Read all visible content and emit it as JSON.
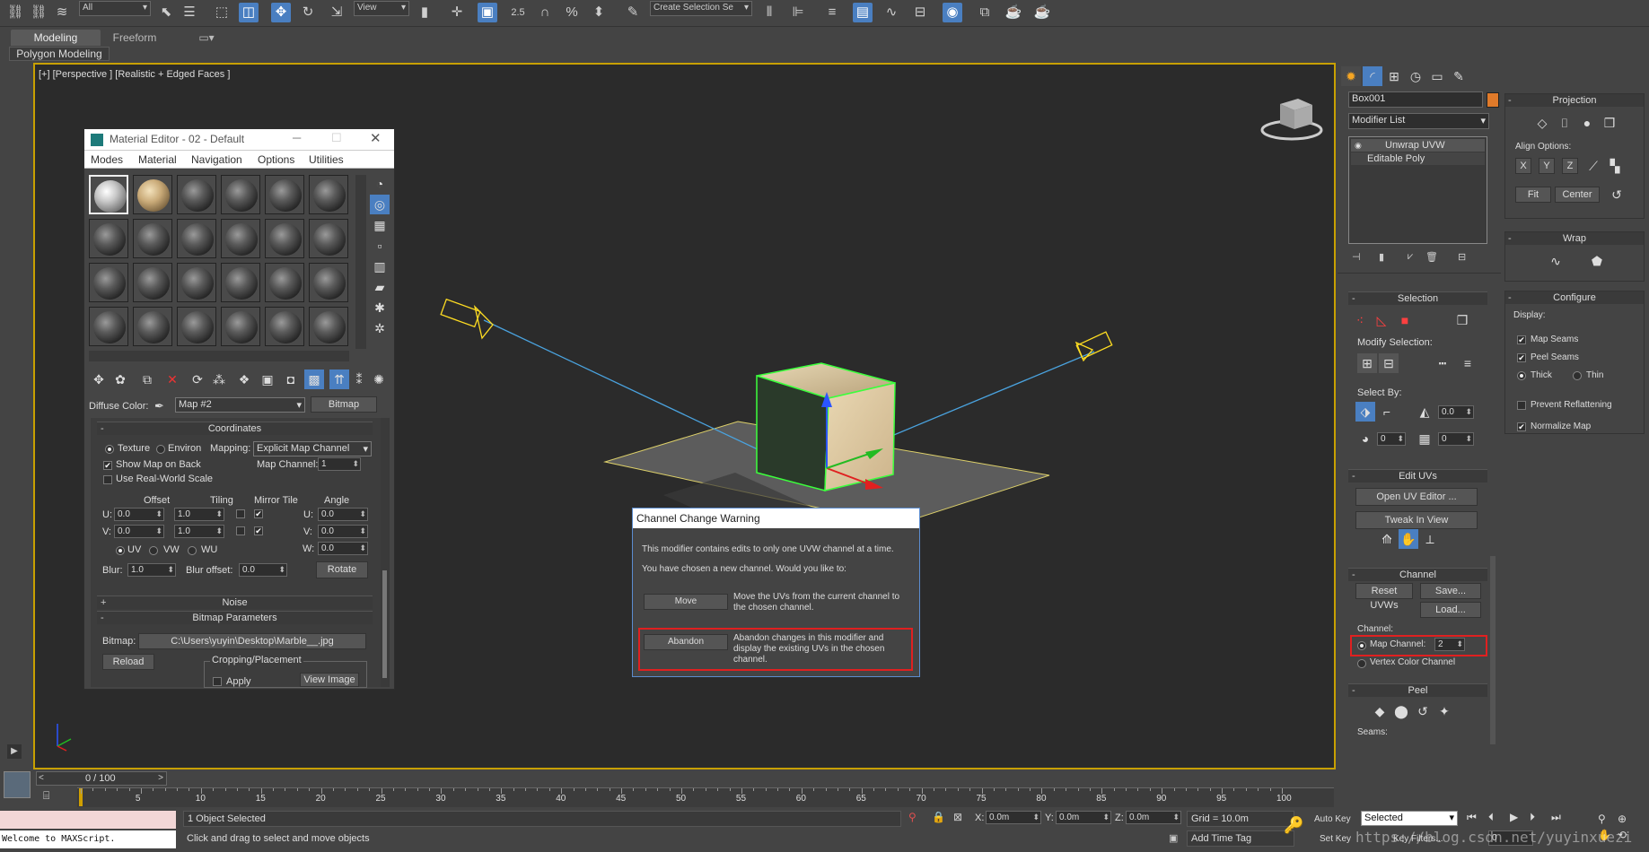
{
  "toolbar": {
    "filter_select": "All",
    "ref_coord_select": "View",
    "snap_label": "2.5",
    "named_selection_placeholder": "Create Selection Se"
  },
  "ribbon": {
    "tabs": [
      "Modeling",
      "Freeform"
    ],
    "subtab": "Polygon Modeling"
  },
  "viewport": {
    "label": "[+] [Perspective ] [Realistic + Edged Faces ]"
  },
  "material_editor": {
    "title": "Material Editor - 02 - Default",
    "menu": [
      "Modes",
      "Material",
      "Navigation",
      "Options",
      "Utilities"
    ],
    "diffuse_label": "Diffuse Color:",
    "map_name": "Map #2",
    "map_type": "Bitmap",
    "coordinates": {
      "title": "Coordinates",
      "texture": "Texture",
      "environ": "Environ",
      "mapping_label": "Mapping:",
      "mapping_value": "Explicit Map Channel",
      "show_map_on_back": "Show Map on Back",
      "map_channel_label": "Map Channel:",
      "map_channel_value": "1",
      "use_real_world": "Use Real-World Scale",
      "offset": "Offset",
      "tiling": "Tiling",
      "mirror_tile": "Mirror Tile",
      "angle": "Angle",
      "u": "U:",
      "v": "V:",
      "w": "W:",
      "u_offset": "0.0",
      "v_offset": "0.0",
      "u_tiling": "1.0",
      "v_tiling": "1.0",
      "u_angle": "0.0",
      "v_angle": "0.0",
      "w_angle": "0.0",
      "uv": "UV",
      "vw": "VW",
      "wu": "WU",
      "blur_label": "Blur:",
      "blur_value": "1.0",
      "blur_offset_label": "Blur offset:",
      "blur_offset_value": "0.0",
      "rotate": "Rotate"
    },
    "noise_title": "Noise",
    "bitmap_params_title": "Bitmap Parameters",
    "bitmap_label": "Bitmap:",
    "bitmap_path": "C:\\Users\\yuyin\\Desktop\\Marble__.jpg",
    "reload": "Reload",
    "cropping": "Cropping/Placement",
    "apply": "Apply",
    "view_image": "View Image"
  },
  "dialog": {
    "title": "Channel Change Warning",
    "line1": "This modifier contains edits to only one UVW channel at a time.",
    "line2": "You have chosen a new channel. Would you like to:",
    "move_label": "Move",
    "move_desc": "Move the UVs from the current channel to the chosen channel.",
    "abandon_label": "Abandon",
    "abandon_desc": "Abandon changes in this modifier and display the existing UVs in the chosen channel."
  },
  "command_panel": {
    "object_name": "Box001",
    "object_color": "#e07a2a",
    "modifier_list": "Modifier List",
    "stack": [
      "Unwrap UVW",
      "Editable Poly"
    ],
    "selection_title": "Selection",
    "modify_selection": "Modify Selection:",
    "select_by": "Select By:",
    "select_by_angle": "0.0",
    "select_by_v1": "0",
    "select_by_v2": "0",
    "edit_uvs_title": "Edit UVs",
    "open_uv_editor": "Open UV Editor ...",
    "tweak_in_view": "Tweak In View",
    "channel_title": "Channel",
    "reset_uvws": "Reset UVWs",
    "save": "Save...",
    "load": "Load...",
    "channel_label": "Channel:",
    "map_channel_label": "Map Channel:",
    "map_channel_value": "2",
    "vertex_color_channel": "Vertex Color Channel",
    "peel_title": "Peel",
    "seams_label": "Seams:"
  },
  "right_panel": {
    "projection_title": "Projection",
    "align_options": "Align Options:",
    "align_buttons": [
      "X",
      "Y",
      "Z"
    ],
    "fit": "Fit",
    "center": "Center",
    "wrap_title": "Wrap",
    "configure_title": "Configure",
    "display_label": "Display:",
    "map_seams": "Map Seams",
    "peel_seams": "Peel Seams",
    "thick": "Thick",
    "thin": "Thin",
    "prevent_reflattening": "Prevent Reflattening",
    "normalize_map": "Normalize Map"
  },
  "timeline": {
    "frame_counter": "0 / 100",
    "ticks": [
      "5",
      "10",
      "15",
      "20",
      "25",
      "30",
      "35",
      "40",
      "45",
      "50",
      "55",
      "60",
      "65",
      "70",
      "75",
      "80",
      "85",
      "90",
      "95",
      "100"
    ]
  },
  "status": {
    "maxscript": "Welcome to MAXScript.",
    "selected": "1 Object Selected",
    "prompt": "Click and drag to select and move objects",
    "x_label": "X:",
    "x_value": "0.0m",
    "y_label": "Y:",
    "y_value": "0.0m",
    "z_label": "Z:",
    "z_value": "0.0m",
    "grid": "Grid = 10.0m",
    "add_time_tag": "Add Time Tag",
    "auto_key": "Auto Key",
    "selected_dropdown": "Selected",
    "set_key": "Set Key",
    "key_filters": "Key Filters...",
    "frame_value": "0",
    "watermark": "https://blog.csdn.net/yuyinxuezi"
  }
}
